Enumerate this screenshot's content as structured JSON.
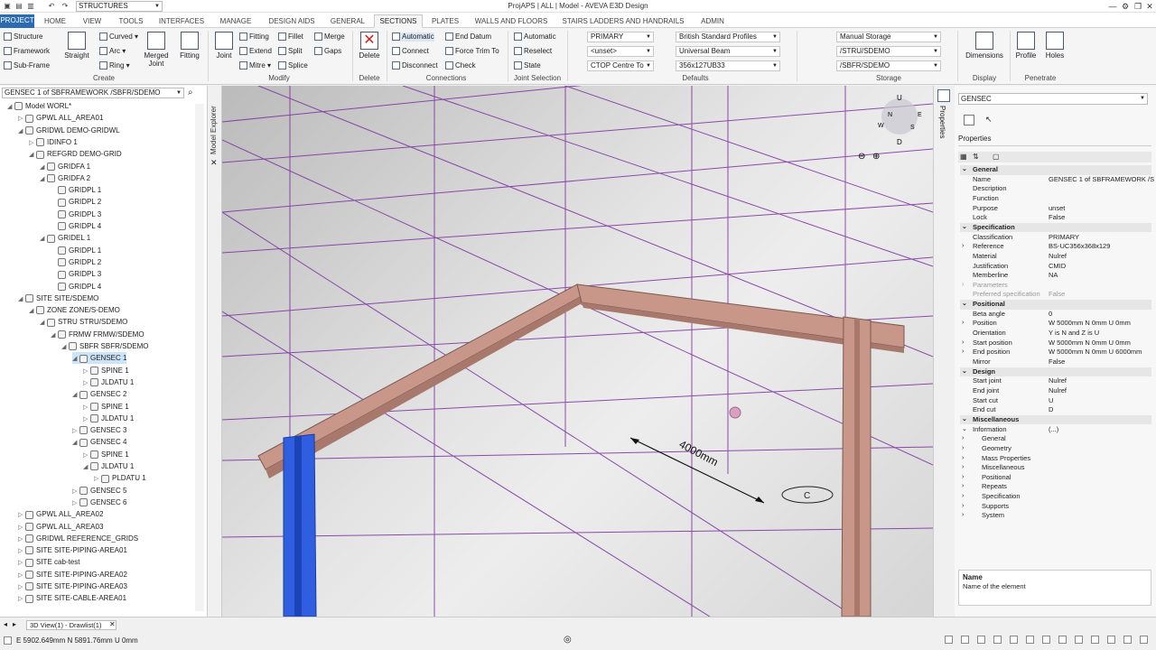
{
  "app": {
    "window_title": "ProjAPS | ALL | Model - AVEVA E3D Design",
    "module_combo": "STRUCTURES"
  },
  "tabs": [
    "PROJECT",
    "HOME",
    "VIEW",
    "TOOLS",
    "INTERFACES",
    "MANAGE",
    "DESIGN AIDS",
    "GENERAL",
    "SECTIONS",
    "PLATES",
    "WALLS AND FLOORS",
    "STAIRS LADDERS AND HANDRAILS",
    "ADMIN"
  ],
  "ribbon": {
    "create": {
      "label": "Create",
      "structure": "Structure",
      "framework": "Framework",
      "subframe": "Sub-Frame",
      "straight": "Straight",
      "curved": "Curved",
      "arc": "Arc",
      "ring": "Ring",
      "merged_joint_1": "Merged",
      "merged_joint_2": "Joint",
      "fitting": "Fitting"
    },
    "modify": {
      "label": "Modify",
      "joint": "Joint",
      "fitting": "Fitting",
      "fillet": "Fillet",
      "merge": "Merge",
      "extend": "Extend",
      "split": "Split",
      "gaps": "Gaps",
      "mitre": "Mitre",
      "splice": "Splice"
    },
    "delete": {
      "label": "Delete",
      "delete": "Delete"
    },
    "connections": {
      "label": "Connections",
      "automatic": "Automatic",
      "end_datum": "End Datum",
      "connect": "Connect",
      "force_trim_to": "Force Trim To",
      "disconnect": "Disconnect",
      "check": "Check"
    },
    "joint_selection": {
      "label": "Joint Selection",
      "automatic": "Automatic",
      "reselect": "Reselect",
      "state": "State"
    },
    "defaults": {
      "label": "Defaults",
      "primary": "PRIMARY",
      "unset": "<unset>",
      "ctop": "CTOP Centre To",
      "profiles": "British Standard Profiles",
      "beam": "Universal Beam",
      "size": "356x127UB33"
    },
    "storage": {
      "label": "Storage",
      "manual": "Manual Storage",
      "stru": "/STRU/SDEMO",
      "sbfr": "/SBFR/SDEMO"
    },
    "display": {
      "label": "Display",
      "dimensions": "Dimensions"
    },
    "penetrate": {
      "label": "Penetrate",
      "profile": "Profile",
      "holes": "Holes"
    }
  },
  "explorer": {
    "scope": "GENSEC 1 of SBFRAMEWORK /SBFR/SDEMO",
    "side_label": "Model Explorer",
    "tree": [
      {
        "label": "Model WORL*",
        "level": 0,
        "exp": "◢"
      },
      {
        "label": "GPWL ALL_AREA01",
        "level": 1,
        "exp": "▷"
      },
      {
        "label": "GRIDWL DEMO-GRIDWL",
        "level": 1,
        "exp": "◢"
      },
      {
        "label": "IDINFO 1",
        "level": 2,
        "exp": "▷"
      },
      {
        "label": "REFGRD DEMO-GRID",
        "level": 2,
        "exp": "◢"
      },
      {
        "label": "GRIDFA 1",
        "level": 3,
        "exp": "◢"
      },
      {
        "label": "GRIDFA 2",
        "level": 3,
        "exp": "◢"
      },
      {
        "label": "GRIDPL 1",
        "level": 4,
        "exp": ""
      },
      {
        "label": "GRIDPL 2",
        "level": 4,
        "exp": ""
      },
      {
        "label": "GRIDPL 3",
        "level": 4,
        "exp": ""
      },
      {
        "label": "GRIDPL 4",
        "level": 4,
        "exp": ""
      },
      {
        "label": "GRIDEL 1",
        "level": 3,
        "exp": "◢"
      },
      {
        "label": "GRIDPL 1",
        "level": 4,
        "exp": ""
      },
      {
        "label": "GRIDPL 2",
        "level": 4,
        "exp": ""
      },
      {
        "label": "GRIDPL 3",
        "level": 4,
        "exp": ""
      },
      {
        "label": "GRIDPL 4",
        "level": 4,
        "exp": ""
      },
      {
        "label": "SITE SITE/SDEMO",
        "level": 1,
        "exp": "◢"
      },
      {
        "label": "ZONE ZONE/S-DEMO",
        "level": 2,
        "exp": "◢"
      },
      {
        "label": "STRU STRU/SDEMO",
        "level": 3,
        "exp": "◢"
      },
      {
        "label": "FRMW FRMW/SDEMO",
        "level": 4,
        "exp": "◢"
      },
      {
        "label": "SBFR SBFR/SDEMO",
        "level": 5,
        "exp": "◢"
      },
      {
        "label": "GENSEC 1",
        "level": 6,
        "exp": "◢",
        "sel": true
      },
      {
        "label": "SPINE 1",
        "level": 7,
        "exp": "▷"
      },
      {
        "label": "JLDATU 1",
        "level": 7,
        "exp": "▷"
      },
      {
        "label": "GENSEC 2",
        "level": 6,
        "exp": "◢"
      },
      {
        "label": "SPINE 1",
        "level": 7,
        "exp": "▷"
      },
      {
        "label": "JLDATU 1",
        "level": 7,
        "exp": "▷"
      },
      {
        "label": "GENSEC 3",
        "level": 6,
        "exp": "▷"
      },
      {
        "label": "GENSEC 4",
        "level": 6,
        "exp": "◢"
      },
      {
        "label": "SPINE 1",
        "level": 7,
        "exp": "▷"
      },
      {
        "label": "JLDATU 1",
        "level": 7,
        "exp": "◢"
      },
      {
        "label": "PLDATU 1",
        "level": 8,
        "exp": "▷"
      },
      {
        "label": "GENSEC 5",
        "level": 6,
        "exp": "▷"
      },
      {
        "label": "GENSEC 6",
        "level": 6,
        "exp": "▷"
      },
      {
        "label": "GPWL ALL_AREA02",
        "level": 1,
        "exp": "▷"
      },
      {
        "label": "GPWL ALL_AREA03",
        "level": 1,
        "exp": "▷"
      },
      {
        "label": "GRIDWL REFERENCE_GRIDS",
        "level": 1,
        "exp": "▷"
      },
      {
        "label": "SITE SITE-PIPING-AREA01",
        "level": 1,
        "exp": "▷"
      },
      {
        "label": "SITE cab-test",
        "level": 1,
        "exp": "▷"
      },
      {
        "label": "SITE SITE-PIPING-AREA02",
        "level": 1,
        "exp": "▷"
      },
      {
        "label": "SITE SITE-PIPING-AREA03",
        "level": 1,
        "exp": "▷"
      },
      {
        "label": "SITE SITE-CABLE-AREA01",
        "level": 1,
        "exp": "▷"
      }
    ]
  },
  "viewport": {
    "dimension_label": "4000mm",
    "grid_label": "C",
    "cube": {
      "up": "U",
      "n": "N",
      "e": "E",
      "s": "S",
      "w": "W",
      "d": "D"
    }
  },
  "properties": {
    "side_label": "Properties",
    "element": "GENSEC",
    "tab": "Properties",
    "rows": [
      {
        "cat": true,
        "k": "General"
      },
      {
        "k": "Name",
        "v": "GENSEC 1 of SBFRAMEWORK /S"
      },
      {
        "k": "Description",
        "v": ""
      },
      {
        "k": "Function",
        "v": ""
      },
      {
        "k": "Purpose",
        "v": "unset"
      },
      {
        "k": "Lock",
        "v": "False"
      },
      {
        "cat": true,
        "k": "Specification"
      },
      {
        "k": "Classification",
        "v": "PRIMARY"
      },
      {
        "k": "Reference",
        "v": "BS-UC356x368x129",
        "exp": "›"
      },
      {
        "k": "Material",
        "v": "Nulref"
      },
      {
        "k": "Justification",
        "v": "CMID"
      },
      {
        "k": "Memberline",
        "v": "NA"
      },
      {
        "k": "Parameters",
        "v": "",
        "dim": true,
        "exp": "›"
      },
      {
        "k": "Preferred specification",
        "v": "False",
        "dim": true
      },
      {
        "cat": true,
        "k": "Positional"
      },
      {
        "k": "Beta angle",
        "v": "0"
      },
      {
        "k": "Position",
        "v": "W 5000mm N 0mm U 0mm",
        "exp": "›"
      },
      {
        "k": "Orientation",
        "v": "Y is N and Z is U"
      },
      {
        "k": "Start position",
        "v": "W 5000mm N 0mm U 0mm",
        "exp": "›"
      },
      {
        "k": "End position",
        "v": "W 5000mm N 0mm U 6000mm",
        "exp": "›"
      },
      {
        "k": "Mirror",
        "v": "False"
      },
      {
        "cat": true,
        "k": "Design"
      },
      {
        "k": "Start joint",
        "v": "Nulref"
      },
      {
        "k": "End joint",
        "v": "Nulref"
      },
      {
        "k": "Start cut",
        "v": "U"
      },
      {
        "k": "End cut",
        "v": "D"
      },
      {
        "cat": true,
        "k": "Miscellaneous"
      },
      {
        "k": "Information",
        "v": "(...)",
        "exp": "⌄"
      },
      {
        "k": "General",
        "v": "",
        "sub": true
      },
      {
        "k": "Geometry",
        "v": "",
        "sub": true
      },
      {
        "k": "Mass Properties",
        "v": "",
        "sub": true
      },
      {
        "k": "Miscellaneous",
        "v": "",
        "sub": true
      },
      {
        "k": "Positional",
        "v": "",
        "sub": true
      },
      {
        "k": "Repeats",
        "v": "",
        "sub": true
      },
      {
        "k": "Specification",
        "v": "",
        "sub": true
      },
      {
        "k": "Supports",
        "v": "",
        "sub": true
      },
      {
        "k": "System",
        "v": "",
        "sub": true
      }
    ],
    "desc_title": "Name",
    "desc_text": "Name of the element"
  },
  "status": {
    "doc_tab": "3D View(1) - Drawlist(1)",
    "coords": "E 5902.649mm N 5891.76mm U 0mm"
  },
  "colors": {
    "accent": "#2b6cb0",
    "grid": "#7b2fa0",
    "beam": "#c9968a",
    "column_selected": "#2f5fe0",
    "selection": "#cce4f7"
  }
}
